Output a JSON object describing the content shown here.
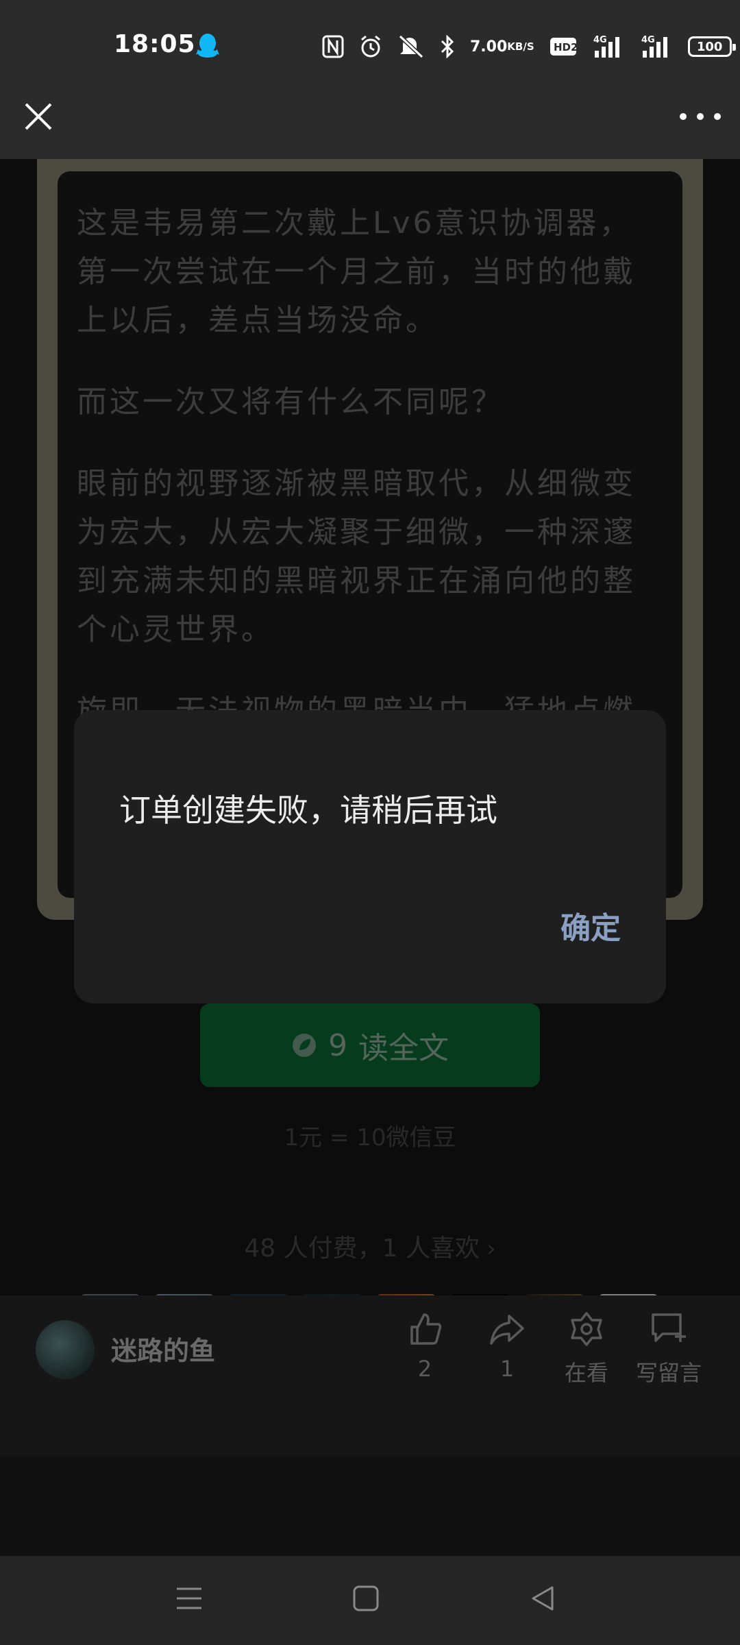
{
  "status_bar": {
    "time": "18:05",
    "net_speed_value": "7.00",
    "net_speed_unit": "KB/S",
    "hd_label": "HD2",
    "network_1": "4G",
    "network_2": "4G",
    "battery": "100"
  },
  "app_bar": {
    "close_icon": "close-icon",
    "more_icon": "more-icon"
  },
  "article": {
    "paragraphs": [
      "这是韦易第二次戴上Lv6意识协调器，第一次尝试在一个月之前，当时的他戴上以后，差点当场没命。",
      "而这一次又将有什么不同呢？",
      "眼前的视野逐渐被黑暗取代，从细微变为宏大，从宏大凝聚于细微，一种深邃到充满未知的黑暗视界正在涌向他的整个心灵世界。",
      "旋即，无法视物的黑暗当中，猛地点燃"
    ]
  },
  "paywall": {
    "read_button_price": "9",
    "read_button_label": "读全文",
    "rate_text": "1元 = 10微信豆",
    "stats_text": "48 人付费，1 人喜欢",
    "stats_chevron": "›"
  },
  "bottom_bar": {
    "author_name": "迷路的鱼",
    "like_count": "2",
    "share_count": "1",
    "watching_label": "在看",
    "comment_label": "写留言"
  },
  "dialog": {
    "message": "订单创建失败，请稍后再试",
    "confirm_label": "确定"
  },
  "colors": {
    "accent_green": "#07c160",
    "dialog_link": "#8aa0c2",
    "qq_blue": "#12b7f5"
  }
}
